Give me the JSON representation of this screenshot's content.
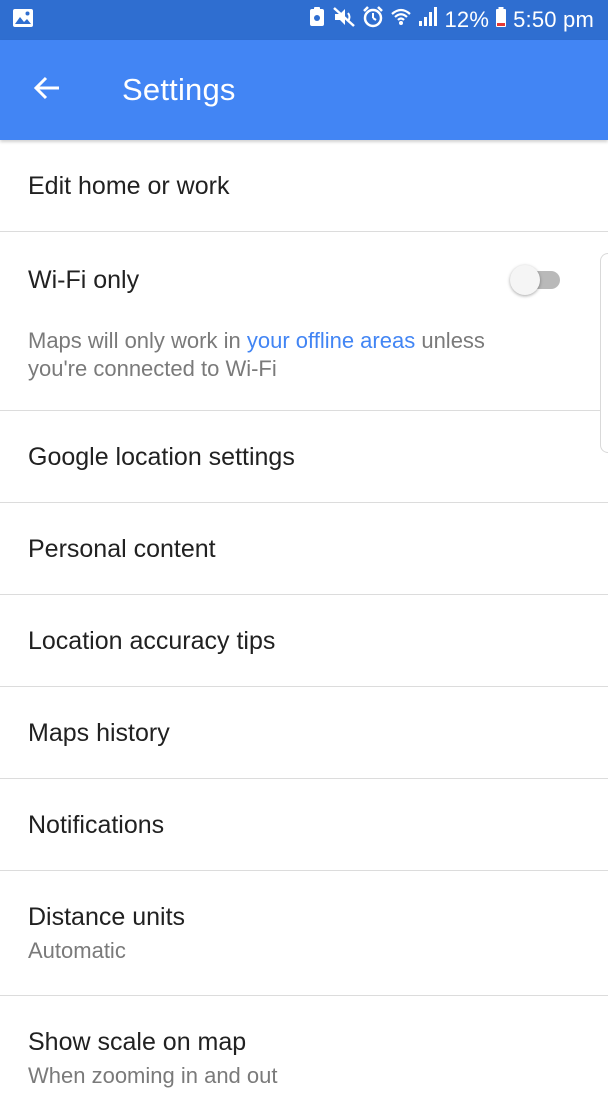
{
  "status_bar": {
    "battery_percent": "12%",
    "time": "5:50 pm",
    "icons": [
      "image-icon",
      "lock-notification-icon",
      "mute-icon",
      "alarm-icon",
      "wifi-icon",
      "signal-icon",
      "battery-icon"
    ]
  },
  "app_bar": {
    "title": "Settings",
    "back_icon": "arrow-back-icon",
    "background": "#4285f4"
  },
  "settings": {
    "edit_home_work": {
      "title": "Edit home or work"
    },
    "wifi_only": {
      "title": "Wi-Fi only",
      "enabled": false,
      "desc_before": "Maps will only work in ",
      "desc_link": "your offline areas",
      "desc_after": " unless you're connected to Wi-Fi"
    },
    "location_settings": {
      "title": "Google location settings"
    },
    "personal_content": {
      "title": "Personal content"
    },
    "accuracy_tips": {
      "title": "Location accuracy tips"
    },
    "maps_history": {
      "title": "Maps history"
    },
    "notifications": {
      "title": "Notifications"
    },
    "distance_units": {
      "title": "Distance units",
      "value": "Automatic"
    },
    "show_scale": {
      "title": "Show scale on map",
      "value": "When zooming in and out"
    }
  },
  "colors": {
    "status_bar": "#2f6ed0",
    "link": "#4285f4",
    "toggle_off_track": "#b9b9b9"
  }
}
